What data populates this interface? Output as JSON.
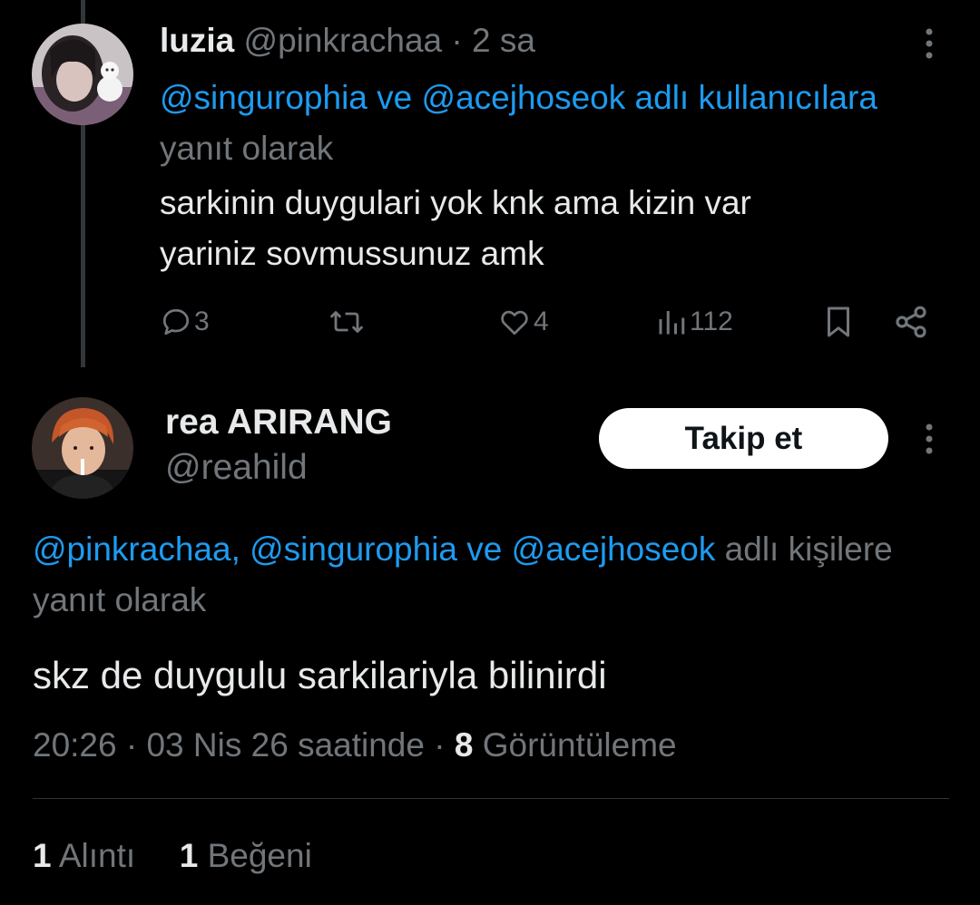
{
  "colors": {
    "background": "#000000",
    "text_primary": "#e7e9ea",
    "text_secondary": "#71767b",
    "link": "#1d9bf0",
    "follow_button_bg": "#ffffff"
  },
  "parent_tweet": {
    "display_name": "luzia",
    "handle": "@pinkrachaa",
    "separator": "·",
    "time_ago": "2 sa",
    "reply_context": {
      "mention_1": "@singurophia",
      "joiner": "ve",
      "mention_2": "@acejhoseok",
      "suffix_link": "adlı kullanıcılara",
      "suffix_text": "yanıt olarak"
    },
    "text_line_1": "sarkinin duygulari yok knk ama kizin var",
    "text_line_2": "yariniz sovmussunuz amk",
    "actions": {
      "reply_count": "3",
      "retweet_count": "",
      "like_count": "4",
      "views_count": "112"
    },
    "icons": [
      "reply-icon",
      "retweet-icon",
      "like-icon",
      "views-icon",
      "bookmark-icon",
      "share-icon",
      "more-icon"
    ]
  },
  "main_tweet": {
    "display_name": "rea ARIRANG",
    "handle": "@reahild",
    "follow_label": "Takip et",
    "reply_context": {
      "mentions": "@pinkrachaa, @singurophia ve @acejhoseok",
      "suffix": "adlı kişilere yanıt olarak"
    },
    "text": "skz de duygulu sarkilariyla bilinirdi",
    "meta": {
      "time": "20:26",
      "separator": "·",
      "date": "03 Nis 26 saatinde",
      "views_count": "8",
      "views_label": "Görüntüleme"
    },
    "stats": {
      "quotes_count": "1",
      "quotes_label": "Alıntı",
      "likes_count": "1",
      "likes_label": "Beğeni"
    }
  }
}
